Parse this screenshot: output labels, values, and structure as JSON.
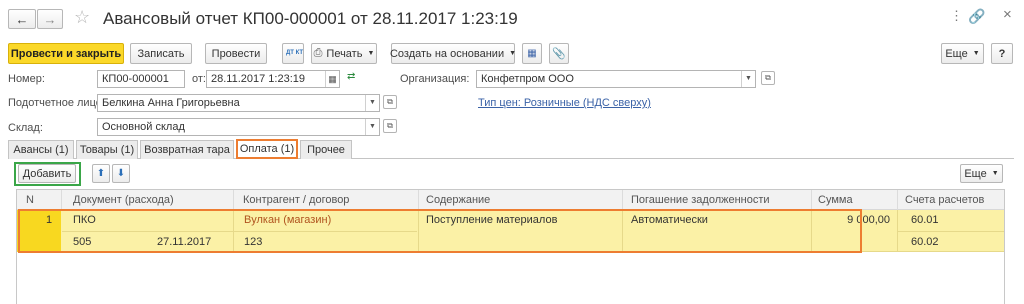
{
  "window": {
    "title": "Авансовый отчет КП00-000001 от 28.11.2017 1:23:19"
  },
  "toolbar": {
    "post_close": "Провести и закрыть",
    "save": "Записать",
    "post": "Провести",
    "dtkt": "ДТ КТ",
    "print": "Печать",
    "create_based": "Создать на основании",
    "more": "Еще",
    "help": "?"
  },
  "form": {
    "number_label": "Номер:",
    "number_value": "КП00-000001",
    "date_label": "от:",
    "date_value": "28.11.2017  1:23:19",
    "org_label": "Организация:",
    "org_value": "Конфетпром ООО",
    "person_label": "Подотчетное лицо:",
    "person_value": "Белкина Анна Григорьевна",
    "price_type_link": "Тип цен: Розничные (НДС сверху)",
    "warehouse_label": "Склад:",
    "warehouse_value": "Основной склад"
  },
  "tabs": [
    {
      "label": "Авансы (1)"
    },
    {
      "label": "Товары (1)"
    },
    {
      "label": "Возвратная тара"
    },
    {
      "label": "Оплата (1)"
    },
    {
      "label": "Прочее"
    }
  ],
  "table_toolbar": {
    "add": "Добавить",
    "more": "Еще"
  },
  "table": {
    "columns": [
      "N",
      "Документ (расхода)",
      "Контрагент / договор",
      "Содержание",
      "Погашение задолженности",
      "Сумма",
      "Счета расчетов"
    ],
    "row": {
      "n": "1",
      "doc": "ПКО",
      "doc_num": "505",
      "doc_date": "27.11.2017",
      "counterparty": "Вулкан (магазин)",
      "contract": "123",
      "content": "Поступление материалов",
      "repayment": "Автоматически",
      "sum": "9 000,00",
      "account1": "60.01",
      "account2": "60.02"
    }
  },
  "colors": {
    "accent_yellow": "#fbd829",
    "highlight_orange": "#ed7d31",
    "highlight_green": "#3aa648",
    "row_selected": "#fbf1a6",
    "link": "#3a62a7",
    "counterparty_text": "#b0541f"
  }
}
